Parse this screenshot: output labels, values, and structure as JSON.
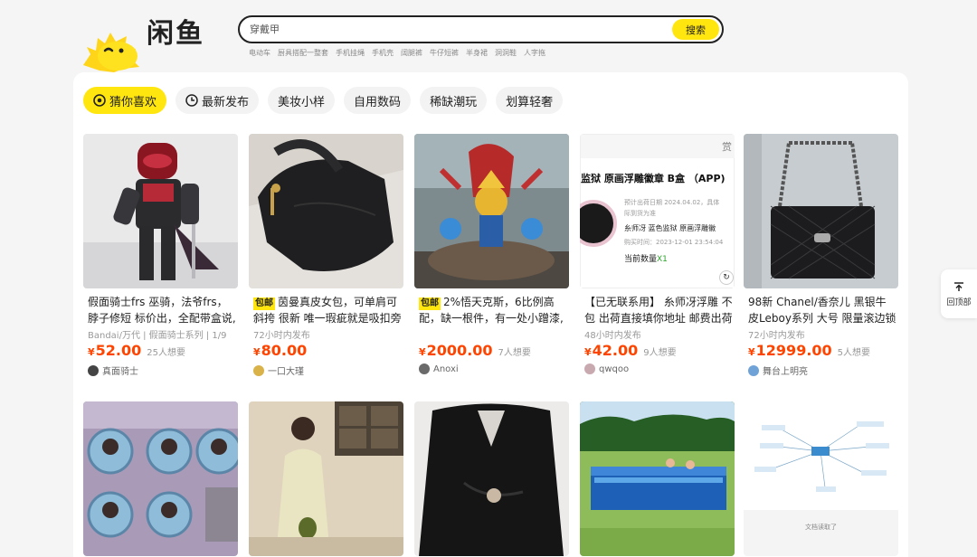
{
  "header": {
    "logo_text": "闲鱼",
    "search_value": "穿戴甲",
    "search_button": "搜索",
    "hot_words": [
      "电动车",
      "厨具搭配一整套",
      "手机挂绳",
      "手机壳",
      "阔腿裤",
      "牛仔短裤",
      "半身裙",
      "洞洞鞋",
      "人字拖"
    ]
  },
  "tabs": [
    {
      "label": "猜你喜欢",
      "icon": "eye-icon",
      "active": true
    },
    {
      "label": "最新发布",
      "icon": "clock-icon",
      "active": false
    },
    {
      "label": "美妆小样",
      "active": false
    },
    {
      "label": "自用数码",
      "active": false
    },
    {
      "label": "稀缺潮玩",
      "active": false
    },
    {
      "label": "划算轻奢",
      "active": false
    }
  ],
  "cards": [
    {
      "title": "假面骑士frs 巫骑，法爷frs，脖子修短 标价出，全配带盒说,",
      "badge": "",
      "meta": "Bandai/万代 | 假面骑士系列 | 1/9",
      "price": "52.00",
      "want": "25人想要",
      "seller": "真面骑士"
    },
    {
      "title": "茵曼真皮女包，可单肩可斜挎 很新 唯一瑕疵就是吸扣旁",
      "badge": "包邮",
      "meta": "72小时内发布",
      "price": "80.00",
      "want": "",
      "seller": "一口大瑾"
    },
    {
      "title": "2%悟天克斯，6比例高配，缺一根件，有一处小蹭漆,",
      "badge": "包邮",
      "meta": "",
      "price": "2000.00",
      "want": "7人想要",
      "seller": "Anoxi"
    },
    {
      "title": "【已无联系用】 糸师冴浮雕 不包 出荷直接填你地址 邮费出荷",
      "badge": "",
      "meta": "48小时内发布",
      "price": "42.00",
      "want": "9人想要",
      "seller": "qwqoo"
    },
    {
      "title": "98新 Chanel/香奈儿 黑银牛皮Leboy系列 大号 限量滚边锁链",
      "badge": "",
      "meta": "72小时内发布",
      "price": "12999.00",
      "want": "5人想要",
      "seller": "舞台上明亮"
    }
  ],
  "card4_image": {
    "heading": "监狱 原画浮雕徽章 B盒 （APP)",
    "line1": "预计出荷日期 2024.04.02，具体",
    "line2": "际到货为准",
    "name": "糸师冴 蓝色监狱 原画浮雕徽",
    "line3": "购买时间：2023-12-01 23:54:04",
    "qty_label": "当前数量",
    "qty": "X1",
    "corner": "赏"
  },
  "row2_last": {
    "note": "文档读取了"
  },
  "back_top": "回顶部",
  "currency": "¥",
  "colors": {
    "accent": "#ffe60f",
    "price": "#ff4400"
  }
}
